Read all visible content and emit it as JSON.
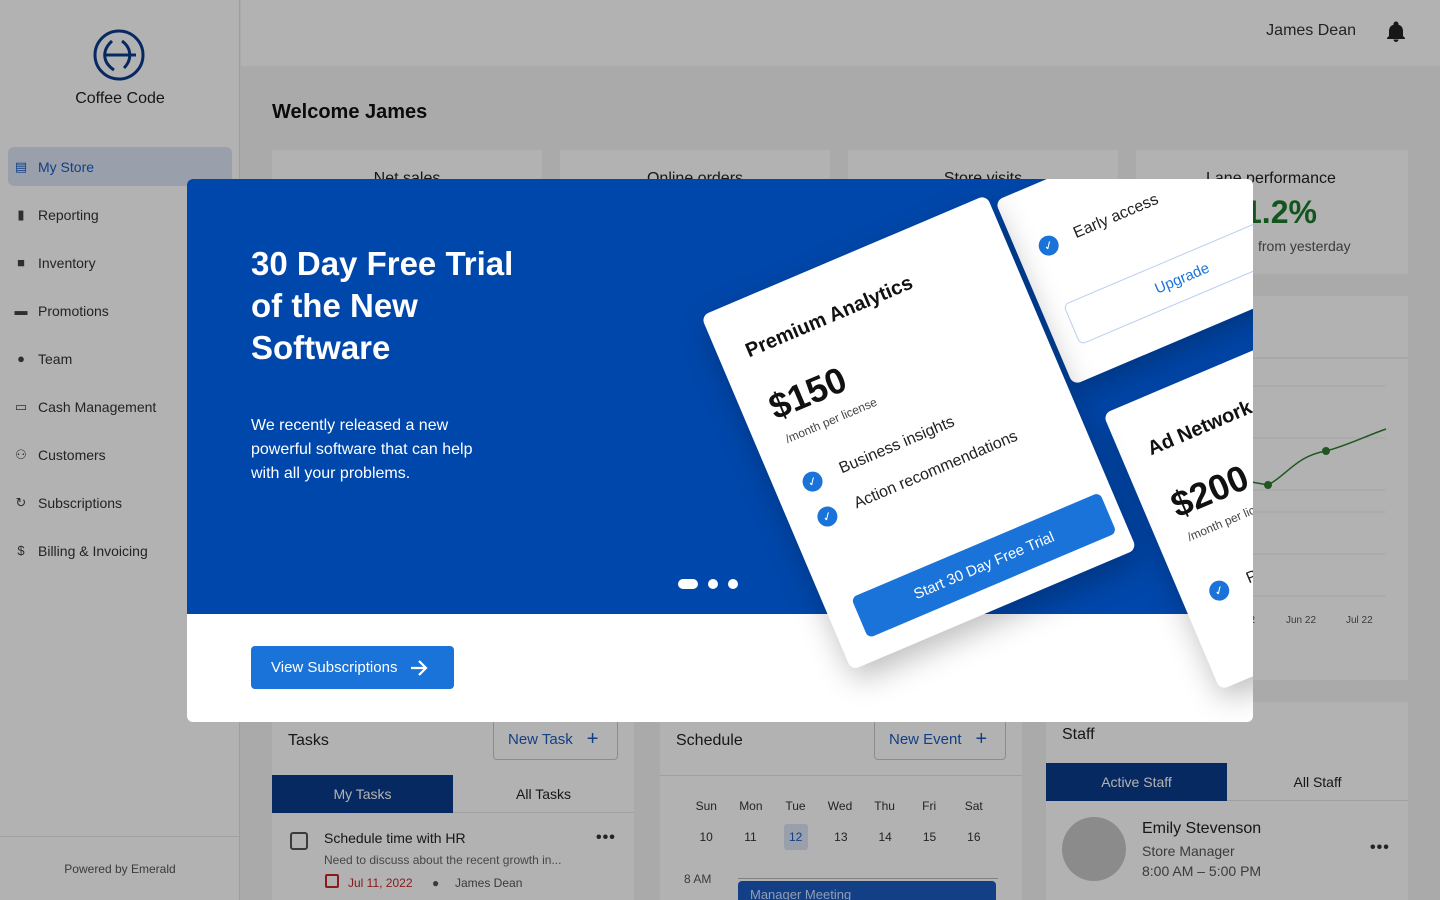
{
  "app": {
    "brand_name": "Coffee Code",
    "powered_by": "Powered by Emerald",
    "accent_color": "#0047ab"
  },
  "sidebar": {
    "items": [
      {
        "label": "My Store",
        "icon": "store-icon",
        "active": true
      },
      {
        "label": "Reporting",
        "icon": "bar-chart-icon"
      },
      {
        "label": "Inventory",
        "icon": "bag-icon"
      },
      {
        "label": "Promotions",
        "icon": "ticket-icon"
      },
      {
        "label": "Team",
        "icon": "globe-icon"
      },
      {
        "label": "Cash Management",
        "icon": "money-icon"
      },
      {
        "label": "Customers",
        "icon": "people-icon"
      },
      {
        "label": "Subscriptions",
        "icon": "refresh-icon"
      },
      {
        "label": "Billing & Invoicing",
        "icon": "dollar-icon"
      }
    ]
  },
  "header": {
    "user_name": "James Dean"
  },
  "main": {
    "welcome": "Welcome James",
    "stats": [
      {
        "title": "Net sales"
      },
      {
        "title": "Online orders"
      },
      {
        "title": "Store visits"
      },
      {
        "title": "Lane performance",
        "value": "1.2%",
        "sub": "from yesterday"
      }
    ],
    "chart": {
      "x_labels": [
        "22",
        "Jun 22",
        "Jul 22"
      ]
    }
  },
  "tasks": {
    "title": "Tasks",
    "new_button": "New Task",
    "tabs": [
      "My Tasks",
      "All Tasks"
    ],
    "item": {
      "title": "Schedule time with HR",
      "desc": "Need to discuss about the recent growth in...",
      "date": "Jul 11, 2022",
      "assignee": "James Dean"
    }
  },
  "schedule": {
    "title": "Schedule",
    "new_button": "New Event",
    "days": [
      "Sun",
      "Mon",
      "Tue",
      "Wed",
      "Thu",
      "Fri",
      "Sat"
    ],
    "dates": [
      "10",
      "11",
      "12",
      "13",
      "14",
      "15",
      "16"
    ],
    "today_index": 2,
    "time": "8 AM",
    "event": "Manager Meeting"
  },
  "staff": {
    "title": "Staff",
    "tabs": [
      "Active Staff",
      "All Staff"
    ],
    "member": {
      "name": "Emily Stevenson",
      "role": "Store Manager",
      "hours": "8:00 AM – 5:00 PM"
    }
  },
  "modal": {
    "title": "30 Day Free Trial of the New Software",
    "text": "We recently released a new powerful software that can help with all your problems.",
    "cta": "View Subscriptions",
    "carousel_total": 3,
    "carousel_active": 1,
    "cards": {
      "premium": {
        "title": "Premium Analytics",
        "price": "$150",
        "per": "/month per license",
        "features": [
          "Business insights",
          "Action recommendations"
        ],
        "cta": "Start 30 Day Free Trial"
      },
      "upgrade": {
        "feature": "Early access",
        "cta": "Upgrade"
      },
      "ad": {
        "title": "Ad Network",
        "price": "$200",
        "per": "/month per license",
        "feature": "Pers tar"
      }
    }
  }
}
